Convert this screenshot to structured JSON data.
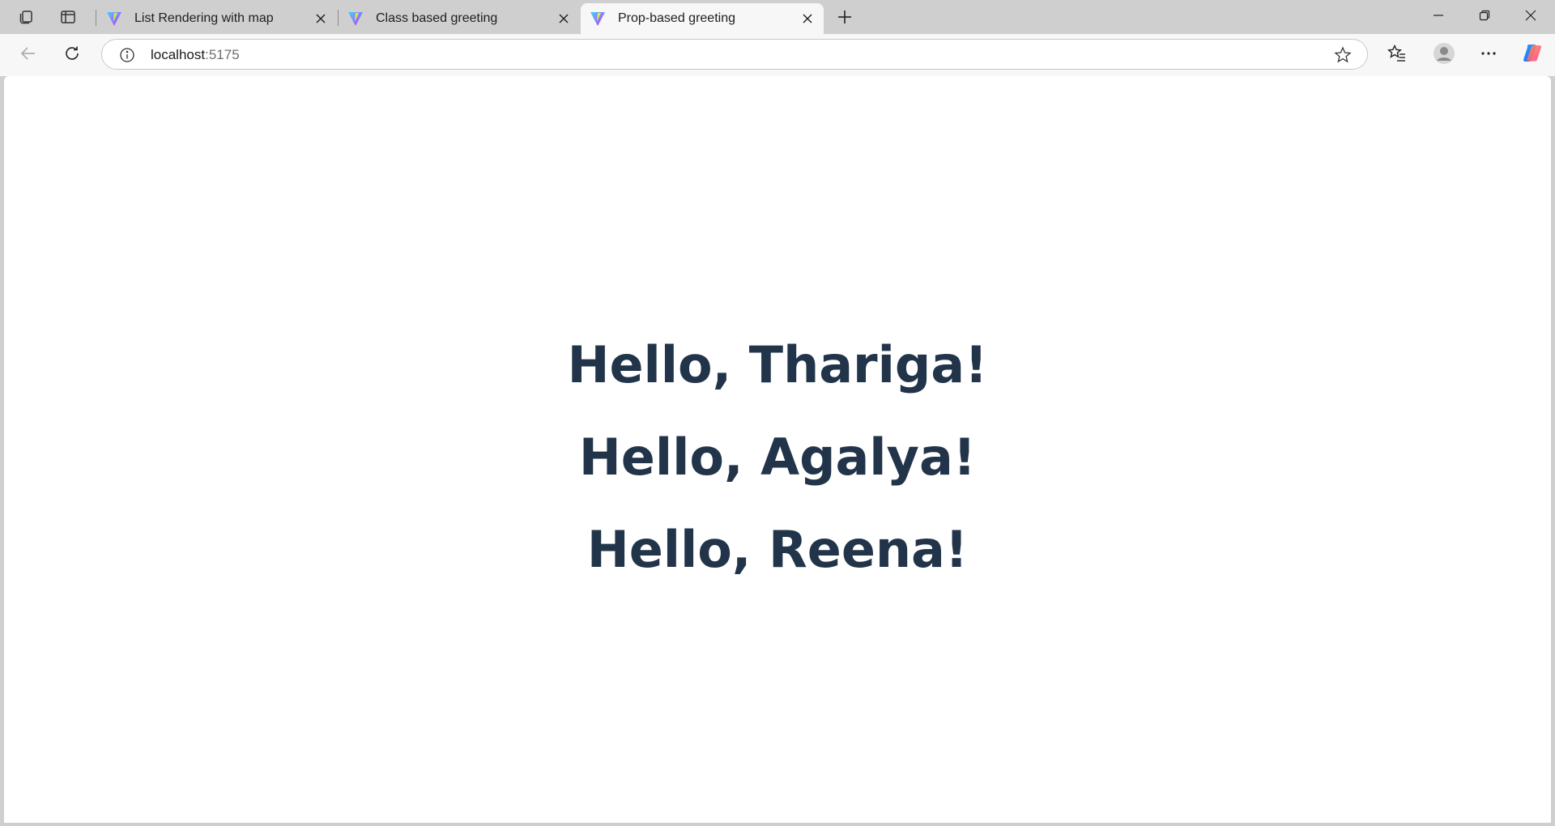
{
  "tabstrip": {
    "tabs": [
      {
        "title": "List Rendering with map",
        "active": false
      },
      {
        "title": "Class based greeting",
        "active": false
      },
      {
        "title": "Prop-based greeting",
        "active": true
      }
    ]
  },
  "toolbar": {
    "url_host": "localhost",
    "url_port": ":5175"
  },
  "page": {
    "greetings": [
      "Hello, Thariga!",
      "Hello, Agalya!",
      "Hello, Reena!"
    ]
  },
  "colors": {
    "heading": "#22344a",
    "tabstrip_bg": "#cfcfcf",
    "toolbar_bg": "#f7f7f7",
    "page_bg": "#ffffff"
  },
  "icons": {
    "favicon": "vite-logo-icon",
    "tab_actions": [
      "workspaces-icon",
      "vertical-tabs-icon"
    ],
    "window_controls": [
      "minimize-icon",
      "restore-icon",
      "close-window-icon"
    ],
    "toolbar": [
      "back-arrow-icon",
      "refresh-icon",
      "info-icon",
      "star-icon",
      "favorites-icon",
      "profile-icon",
      "more-icon",
      "copilot-icon"
    ]
  }
}
